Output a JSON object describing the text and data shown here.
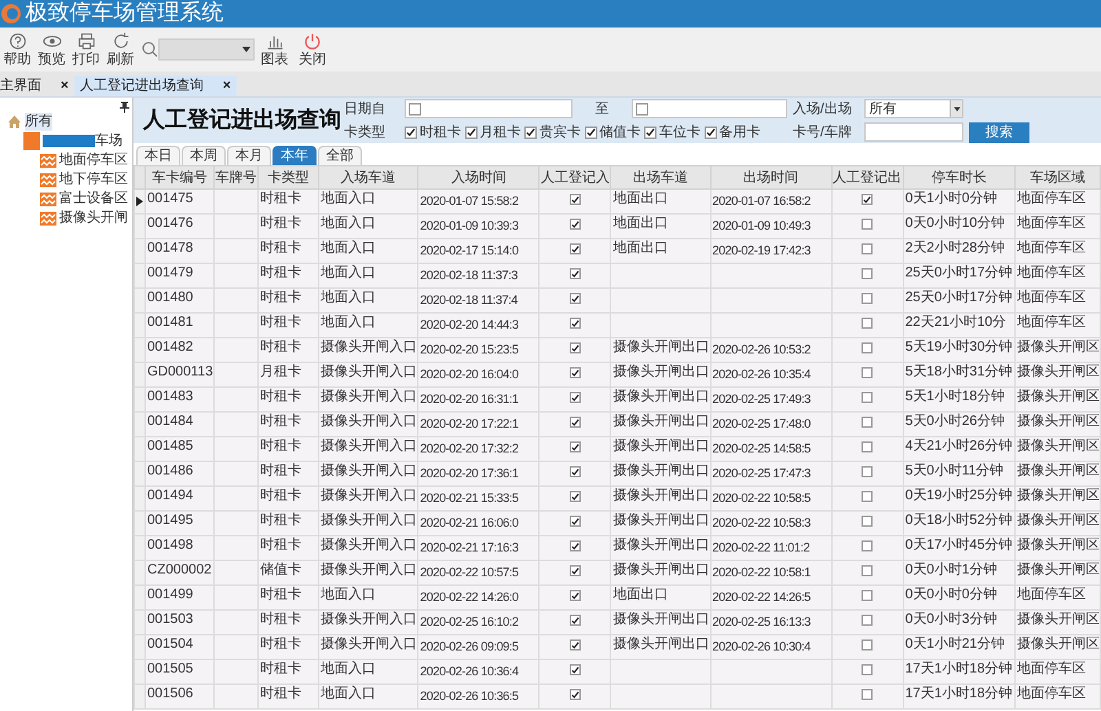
{
  "app": {
    "title": "极致停车场管理系统"
  },
  "toolbar": {
    "left_buttons": [
      {
        "label": "帮助",
        "kind": "help"
      },
      {
        "label": "预览",
        "kind": "preview"
      },
      {
        "label": "打印",
        "kind": "print"
      },
      {
        "label": "刷新",
        "kind": "refresh"
      }
    ],
    "right_buttons": [
      {
        "label": "图表",
        "kind": "chart"
      },
      {
        "label": "关闭",
        "kind": "power"
      }
    ]
  },
  "doc_tabs": [
    {
      "label": "主界面",
      "selected": false,
      "close": "×"
    },
    {
      "label": "人工登记进出场查询",
      "selected": true,
      "close": "×"
    }
  ],
  "tree": {
    "label": "所有",
    "kind": "root",
    "selected": true,
    "children": [
      {
        "label": "车场",
        "kind": "lot",
        "selected": false,
        "redacted": true,
        "children": [
          {
            "label": "地面停车区",
            "kind": "zone",
            "selected": false
          },
          {
            "label": "地下停车区",
            "kind": "zone",
            "selected": false
          },
          {
            "label": "富士设备区",
            "kind": "zone",
            "selected": false
          },
          {
            "label": "摄像头开闸",
            "kind": "zone",
            "selected": false
          }
        ]
      }
    ]
  },
  "query": {
    "title": "人工登记进出场查询",
    "date_from_label": "日期自",
    "date_from_checked": false,
    "date_to_label": "至",
    "date_to_checked": false,
    "direction_label": "入场/出场",
    "direction_value": "所有",
    "card_type_label": "卡类型",
    "card_types": [
      {
        "label": "时租卡",
        "checked": true
      },
      {
        "label": "月租卡",
        "checked": true
      },
      {
        "label": "贵宾卡",
        "checked": true
      },
      {
        "label": "储值卡",
        "checked": true
      },
      {
        "label": "车位卡",
        "checked": true
      },
      {
        "label": "备用卡",
        "checked": true
      }
    ],
    "plate_label": "卡号/车牌",
    "search_button": "搜索"
  },
  "period_tabs": [
    {
      "label": "本日",
      "selected": false
    },
    {
      "label": "本周",
      "selected": false
    },
    {
      "label": "本月",
      "selected": false
    },
    {
      "label": "本年",
      "selected": true
    },
    {
      "label": "全部",
      "selected": false
    }
  ],
  "table": {
    "columns": [
      "车卡编号",
      "车牌号",
      "卡类型",
      "入场车道",
      "入场时间",
      "人工登记入",
      "出场车道",
      "出场时间",
      "人工登记出",
      "停车时长",
      "车场区域"
    ],
    "rows": [
      {
        "selected": true,
        "card_no": "001475",
        "card_type": "时租卡",
        "entry_lane": "地面入口",
        "entry_time": "2020-01-07 15:58:2",
        "manual_in": true,
        "exit_lane": "地面出口",
        "exit_time": "2020-01-07 16:58:2",
        "manual_out": true,
        "duration": "0天1小时0分钟",
        "area": "地面停车区"
      },
      {
        "selected": false,
        "card_no": "001476",
        "card_type": "时租卡",
        "entry_lane": "地面入口",
        "entry_time": "2020-01-09 10:39:3",
        "manual_in": true,
        "exit_lane": "地面出口",
        "exit_time": "2020-01-09 10:49:3",
        "manual_out": false,
        "duration": "0天0小时10分钟",
        "area": "地面停车区"
      },
      {
        "selected": false,
        "card_no": "001478",
        "card_type": "时租卡",
        "entry_lane": "地面入口",
        "entry_time": "2020-02-17 15:14:0",
        "manual_in": true,
        "exit_lane": "地面出口",
        "exit_time": "2020-02-19 17:42:3",
        "manual_out": false,
        "duration": "2天2小时28分钟",
        "area": "地面停车区"
      },
      {
        "selected": false,
        "card_no": "001479",
        "card_type": "时租卡",
        "entry_lane": "地面入口",
        "entry_time": "2020-02-18 11:37:3",
        "manual_in": true,
        "manual_out": false,
        "duration": "25天0小时17分钟",
        "area": "地面停车区"
      },
      {
        "selected": false,
        "card_no": "001480",
        "card_type": "时租卡",
        "entry_lane": "地面入口",
        "entry_time": "2020-02-18 11:37:4",
        "manual_in": true,
        "manual_out": false,
        "duration": "25天0小时17分钟",
        "area": "地面停车区"
      },
      {
        "selected": false,
        "card_no": "001481",
        "card_type": "时租卡",
        "entry_lane": "地面入口",
        "entry_time": "2020-02-20 14:44:3",
        "manual_in": true,
        "manual_out": false,
        "duration": "22天21小时10分",
        "area": "地面停车区"
      },
      {
        "selected": false,
        "card_no": "001482",
        "card_type": "时租卡",
        "entry_lane": "摄像头开闸入口",
        "entry_time": "2020-02-20 15:23:5",
        "manual_in": true,
        "exit_lane": "摄像头开闸出口",
        "exit_time": "2020-02-26 10:53:2",
        "manual_out": false,
        "duration": "5天19小时30分钟",
        "area": "摄像头开闸区"
      },
      {
        "selected": false,
        "card_no": "GD000113",
        "card_type": "月租卡",
        "entry_lane": "摄像头开闸入口",
        "entry_time": "2020-02-20 16:04:0",
        "manual_in": true,
        "exit_lane": "摄像头开闸出口",
        "exit_time": "2020-02-26 10:35:4",
        "manual_out": false,
        "duration": "5天18小时31分钟",
        "area": "摄像头开闸区"
      },
      {
        "selected": false,
        "card_no": "001483",
        "card_type": "时租卡",
        "entry_lane": "摄像头开闸入口",
        "entry_time": "2020-02-20 16:31:1",
        "manual_in": true,
        "exit_lane": "摄像头开闸出口",
        "exit_time": "2020-02-25 17:49:3",
        "manual_out": false,
        "duration": "5天1小时18分钟",
        "area": "摄像头开闸区"
      },
      {
        "selected": false,
        "card_no": "001484",
        "card_type": "时租卡",
        "entry_lane": "摄像头开闸入口",
        "entry_time": "2020-02-20 17:22:1",
        "manual_in": true,
        "exit_lane": "摄像头开闸出口",
        "exit_time": "2020-02-25 17:48:0",
        "manual_out": false,
        "duration": "5天0小时26分钟",
        "area": "摄像头开闸区"
      },
      {
        "selected": false,
        "card_no": "001485",
        "card_type": "时租卡",
        "entry_lane": "摄像头开闸入口",
        "entry_time": "2020-02-20 17:32:2",
        "manual_in": true,
        "exit_lane": "摄像头开闸出口",
        "exit_time": "2020-02-25 14:58:5",
        "manual_out": false,
        "duration": "4天21小时26分钟",
        "area": "摄像头开闸区"
      },
      {
        "selected": false,
        "card_no": "001486",
        "card_type": "时租卡",
        "entry_lane": "摄像头开闸入口",
        "entry_time": "2020-02-20 17:36:1",
        "manual_in": true,
        "exit_lane": "摄像头开闸出口",
        "exit_time": "2020-02-25 17:47:3",
        "manual_out": false,
        "duration": "5天0小时11分钟",
        "area": "摄像头开闸区"
      },
      {
        "selected": false,
        "card_no": "001494",
        "card_type": "时租卡",
        "entry_lane": "摄像头开闸入口",
        "entry_time": "2020-02-21 15:33:5",
        "manual_in": true,
        "exit_lane": "摄像头开闸出口",
        "exit_time": "2020-02-22 10:58:5",
        "manual_out": false,
        "duration": "0天19小时25分钟",
        "area": "摄像头开闸区"
      },
      {
        "selected": false,
        "card_no": "001495",
        "card_type": "时租卡",
        "entry_lane": "摄像头开闸入口",
        "entry_time": "2020-02-21 16:06:0",
        "manual_in": true,
        "exit_lane": "摄像头开闸出口",
        "exit_time": "2020-02-22 10:58:3",
        "manual_out": false,
        "duration": "0天18小时52分钟",
        "area": "摄像头开闸区"
      },
      {
        "selected": false,
        "card_no": "001498",
        "card_type": "时租卡",
        "entry_lane": "摄像头开闸入口",
        "entry_time": "2020-02-21 17:16:3",
        "manual_in": true,
        "exit_lane": "摄像头开闸出口",
        "exit_time": "2020-02-22 11:01:2",
        "manual_out": false,
        "duration": "0天17小时45分钟",
        "area": "摄像头开闸区"
      },
      {
        "selected": false,
        "card_no": "CZ000002",
        "card_type": "储值卡",
        "entry_lane": "摄像头开闸入口",
        "entry_time": "2020-02-22 10:57:5",
        "manual_in": true,
        "exit_lane": "摄像头开闸出口",
        "exit_time": "2020-02-22 10:58:1",
        "manual_out": false,
        "duration": "0天0小时1分钟",
        "area": "摄像头开闸区"
      },
      {
        "selected": false,
        "card_no": "001499",
        "card_type": "时租卡",
        "entry_lane": "地面入口",
        "entry_time": "2020-02-22 14:26:0",
        "manual_in": true,
        "exit_lane": "地面出口",
        "exit_time": "2020-02-22 14:26:5",
        "manual_out": false,
        "duration": "0天0小时0分钟",
        "area": "地面停车区"
      },
      {
        "selected": false,
        "card_no": "001503",
        "card_type": "时租卡",
        "entry_lane": "摄像头开闸入口",
        "entry_time": "2020-02-25 16:10:2",
        "manual_in": true,
        "exit_lane": "摄像头开闸出口",
        "exit_time": "2020-02-25 16:13:3",
        "manual_out": false,
        "duration": "0天0小时3分钟",
        "area": "摄像头开闸区"
      },
      {
        "selected": false,
        "card_no": "001504",
        "card_type": "时租卡",
        "entry_lane": "摄像头开闸入口",
        "entry_time": "2020-02-26 09:09:5",
        "manual_in": true,
        "exit_lane": "摄像头开闸出口",
        "exit_time": "2020-02-26 10:30:4",
        "manual_out": false,
        "duration": "0天1小时21分钟",
        "area": "摄像头开闸区"
      },
      {
        "selected": false,
        "card_no": "001505",
        "card_type": "时租卡",
        "entry_lane": "地面入口",
        "entry_time": "2020-02-26 10:36:4",
        "manual_in": true,
        "manual_out": false,
        "duration": "17天1小时18分钟",
        "area": "地面停车区"
      },
      {
        "selected": false,
        "card_no": "001506",
        "card_type": "时租卡",
        "entry_lane": "地面入口",
        "entry_time": "2020-02-26 10:36:5",
        "manual_in": true,
        "manual_out": false,
        "duration": "17天1小时18分钟",
        "area": "地面停车区"
      }
    ]
  }
}
